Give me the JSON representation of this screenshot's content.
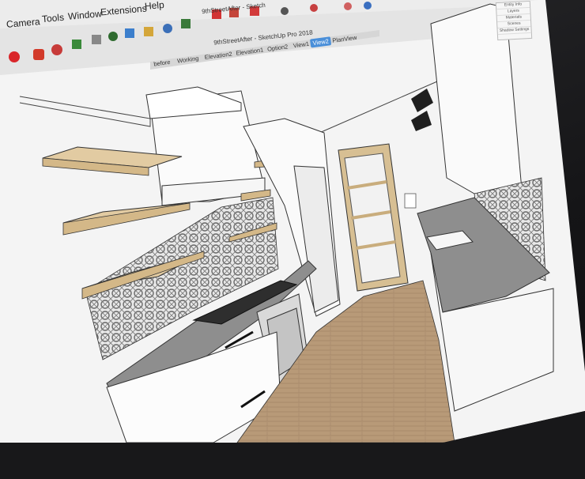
{
  "menu": {
    "items": [
      "Camera",
      "Tools",
      "Window",
      "Extensions",
      "Help"
    ]
  },
  "window": {
    "tab_title": "9thStreetAfter - Sketch",
    "title": "9thStreetAfter - SketchUp Pro 2018"
  },
  "scene_tabs": [
    "before",
    "Working",
    "Elevation2",
    "Elevation1",
    "Option2",
    "View1",
    "View2",
    "PlanView"
  ],
  "active_scene_tab": "View2",
  "tray_panel": {
    "items": [
      "Entity Info",
      "Layers",
      "Materials",
      "Scenes",
      "Shadow Settings"
    ]
  },
  "colors": {
    "accent": "#4a8fd9",
    "wood_floor": "#b89a78",
    "countertop": "#8c8c8c",
    "shelf": "#d9c39a",
    "door_frame": "#d7bf93"
  }
}
